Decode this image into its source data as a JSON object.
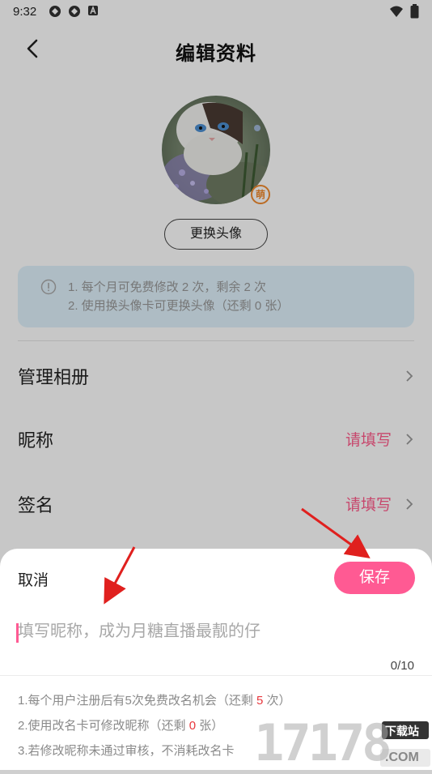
{
  "status_bar": {
    "time": "9:32"
  },
  "header": {
    "title": "编辑资料"
  },
  "avatar": {
    "badge": "萌",
    "change_button": "更换头像"
  },
  "notice": {
    "line1": "1. 每个月可免费修改 2 次，剩余 2 次",
    "line2": "2. 使用换头像卡可更换头像（还剩 0 张）"
  },
  "list": {
    "album": {
      "label": "管理相册"
    },
    "nickname": {
      "label": "昵称",
      "value": "请填写"
    },
    "signature": {
      "label": "签名",
      "value": "请填写"
    }
  },
  "sheet": {
    "cancel": "取消",
    "save": "保存",
    "placeholder": "填写昵称，成为月糖直播最靓的仔",
    "counter": "0/10",
    "rule1_pre": "1.每个用户注册后有5次免费改名机会（还剩 ",
    "rule1_num": "5",
    "rule1_post": " 次）",
    "rule2_pre": "2.使用改名卡可修改昵称（还剩 ",
    "rule2_num": "0",
    "rule2_post": " 张）",
    "rule3": "3.若修改昵称未通过审核，不消耗改名卡"
  },
  "watermark": {
    "text": "17178",
    "sub": "下载站",
    "domain": ".COM"
  },
  "colors": {
    "accent": "#ff5a93",
    "notice_bg": "#dff1fb",
    "highlight": "#e8383d"
  },
  "icons": [
    "back-arrow-icon",
    "chevron-right-icon",
    "info-icon",
    "wifi-icon",
    "battery-icon"
  ]
}
